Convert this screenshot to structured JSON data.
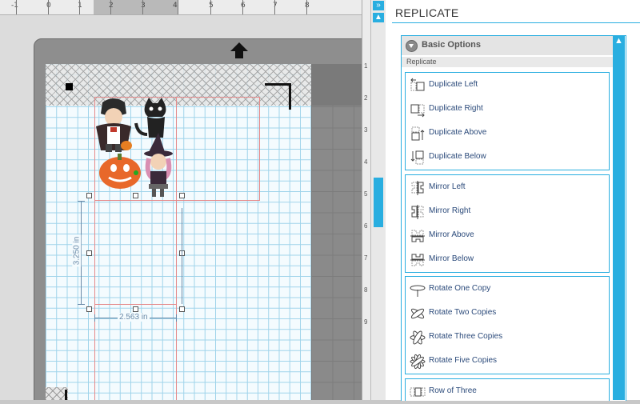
{
  "ruler": {
    "numbers": [
      "-1",
      "0",
      "1",
      "2",
      "3",
      "4",
      "5",
      "6",
      "7",
      "8"
    ]
  },
  "side_ruler": {
    "numbers": [
      "1",
      "2",
      "3",
      "4",
      "5",
      "6",
      "7",
      "8",
      "9"
    ]
  },
  "canvas": {
    "dim_height": "3.250 in",
    "dim_width": "2.563 in"
  },
  "strip": {
    "collapse_icon": "»",
    "up_icon": "▲"
  },
  "panel": {
    "title": "REPLICATE",
    "section": "Basic Options",
    "subsection": "Replicate",
    "groups": [
      {
        "items": [
          {
            "label": "Duplicate Left",
            "icon": "duplicate-left-icon"
          },
          {
            "label": "Duplicate Right",
            "icon": "duplicate-right-icon"
          },
          {
            "label": "Duplicate Above",
            "icon": "duplicate-above-icon"
          },
          {
            "label": "Duplicate Below",
            "icon": "duplicate-below-icon"
          }
        ]
      },
      {
        "items": [
          {
            "label": "Mirror Left",
            "icon": "mirror-left-icon"
          },
          {
            "label": "Mirror Right",
            "icon": "mirror-right-icon"
          },
          {
            "label": "Mirror Above",
            "icon": "mirror-above-icon"
          },
          {
            "label": "Mirror Below",
            "icon": "mirror-below-icon"
          }
        ]
      },
      {
        "items": [
          {
            "label": "Rotate One Copy",
            "icon": "rotate-one-icon"
          },
          {
            "label": "Rotate Two Copies",
            "icon": "rotate-two-icon"
          },
          {
            "label": "Rotate Three Copies",
            "icon": "rotate-three-icon"
          },
          {
            "label": "Rotate Five Copies",
            "icon": "rotate-five-icon"
          }
        ]
      },
      {
        "items": [
          {
            "label": "Row of Three",
            "icon": "row-of-three-icon"
          }
        ]
      }
    ]
  },
  "colors": {
    "accent": "#29aee0",
    "grid": "#9fd3ea",
    "cut_line": "#e58a8a"
  }
}
